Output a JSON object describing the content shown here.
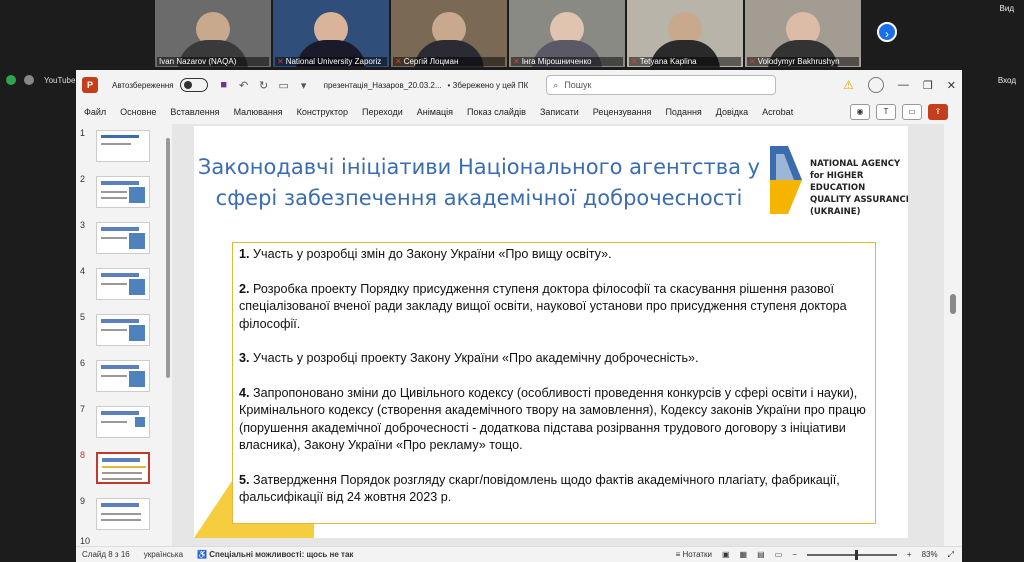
{
  "zoom": {
    "participants": [
      {
        "name": "Ivan Nazarov (NAQA)"
      },
      {
        "name": "National University Zaporiz"
      },
      {
        "name": "Сергій Лоцман"
      },
      {
        "name": "Інга Мірошниченко"
      },
      {
        "name": "Tetyana Kaplina"
      },
      {
        "name": "Volodymyr Bakhrushyn"
      }
    ],
    "view_label": "Вид",
    "exit_label": "Вход",
    "next_icon": "chevron-right-icon"
  },
  "browser": {
    "tab_label": "YouTube"
  },
  "ppt": {
    "autosave_label": "Автозбереження",
    "file_name": "презентація_Назаров_20.03.2...",
    "saved_status": "• Збережено у цей ПК",
    "search_placeholder": "Пошук",
    "menu": [
      "Файл",
      "Основне",
      "Вставлення",
      "Малювання",
      "Конструктор",
      "Переходи",
      "Анімація",
      "Показ слайдів",
      "Записати",
      "Рецензування",
      "Подання",
      "Довідка",
      "Acrobat"
    ],
    "thumbnails": [
      "1",
      "2",
      "3",
      "4",
      "5",
      "6",
      "7",
      "8",
      "9",
      "10"
    ],
    "selected_index": 8,
    "status": {
      "slide": "Слайд 8 з 16",
      "language": "українська",
      "accessibility": "Спеціальні можливості: щось не так",
      "notes": "Нотатки",
      "zoom": "83%"
    }
  },
  "slide": {
    "title_line1": "Законодавчі ініціативи Національного агентства у",
    "title_line2": "сфері забезпечення академічної доброчесності",
    "agency_line1": "NATIONAL AGENCY",
    "agency_line2": "for HIGHER EDUCATION",
    "agency_line3": "QUALITY ASSURANCE",
    "agency_line4": "(UKRAINE)",
    "items": [
      {
        "num": "1.",
        "text": " Участь у розробці змін до Закону України «Про вищу освіту»."
      },
      {
        "num": "2.",
        "text": " Розробка проекту Порядку присудження ступеня доктора філософії та скасування рішення разової спеціалізованої вченої ради закладу вищої освіти, наукової установи про присудження ступеня доктора філософії."
      },
      {
        "num": "3.",
        "text": " Участь у розробці проекту Закону України «Про академічну доброчесність»."
      },
      {
        "num": "4.",
        "text": " Запропоновано зміни до Цивільного кодексу (особливості проведення конкурсів у сфері освіти і науки), Кримінального кодексу (створення академічного твору на замовлення), Кодексу законів України про працю (порушення академічної доброчесності - додаткова підстава розірвання трудового договору з ініціативи власника), Закону України «Про рекламу» тощо."
      },
      {
        "num": "5.",
        "text": " Затвердження Порядок розгляду скарг/повідомлень щодо фактів академічного плагіату, фабрикації, фальсифікації від 24 жовтня 2023 р."
      }
    ]
  }
}
